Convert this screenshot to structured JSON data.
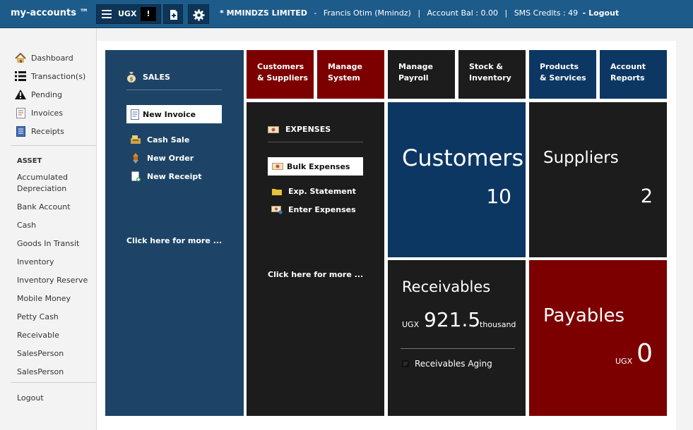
{
  "app": {
    "brand": "my-accounts ™"
  },
  "topbar": {
    "currency": "UGX",
    "alert_mark": "!",
    "company": "* MMINDZS LIMITED",
    "user": "Francis Otim (Mmindz)",
    "account_bal": "Account Bal : 0.00",
    "sms_credits": "SMS Credits : 49",
    "logout": "- Logout",
    "sep": "-",
    "pipe": "|"
  },
  "sidebar": {
    "items": [
      {
        "label": "Dashboard",
        "icon": "house-icon"
      },
      {
        "label": "Transaction(s)",
        "icon": "list-icon"
      },
      {
        "label": "Pending",
        "icon": "warning-icon"
      },
      {
        "label": "Invoices",
        "icon": "invoice-icon"
      },
      {
        "label": "Receipts",
        "icon": "receipt-icon"
      }
    ],
    "group_label": "ASSET",
    "accounts": [
      "Accumulated Depreciation",
      "Bank Account",
      "Cash",
      "Goods In Transit",
      "Inventory",
      "Inventory Reserve",
      "Mobile Money",
      "Petty Cash",
      "Receivable",
      "SalesPerson",
      "SalesPerson"
    ],
    "logout": "Logout"
  },
  "sales": {
    "title": "SALES",
    "primary": "New Invoice",
    "links": [
      "Cash Sale",
      "New Order",
      "New Receipt"
    ],
    "more": "Click here for more ..."
  },
  "menu_tiles": [
    {
      "line1": "Customers",
      "line2": "& Suppliers"
    },
    {
      "line1": "Manage",
      "line2": "System"
    },
    {
      "line1": "Manage",
      "line2": "Payroll"
    },
    {
      "line1": "Stock &",
      "line2": "Inventory"
    },
    {
      "line1": "Products",
      "line2": "& Services"
    },
    {
      "line1": "Account",
      "line2": "Reports"
    }
  ],
  "expenses": {
    "title": "EXPENSES",
    "primary": "Bulk Expenses",
    "links": [
      "Exp. Statement",
      "Enter Expenses"
    ],
    "more": "Click here for more ..."
  },
  "kpis": {
    "customers": {
      "label": "Customers",
      "value": "10"
    },
    "suppliers": {
      "label": "Suppliers",
      "value": "2"
    },
    "receivables": {
      "label": "Receivables",
      "currency": "UGX",
      "value": "921.5",
      "unit": "thousand",
      "aging": "Receivables Aging"
    },
    "payables": {
      "label": "Payables",
      "currency": "UGX",
      "value": "0"
    }
  },
  "colors": {
    "topbar": "#1d5b8a",
    "sales": "#1d4466",
    "navy": "#0c3763",
    "maroon": "#7c0000",
    "black": "#1c1c1c"
  }
}
